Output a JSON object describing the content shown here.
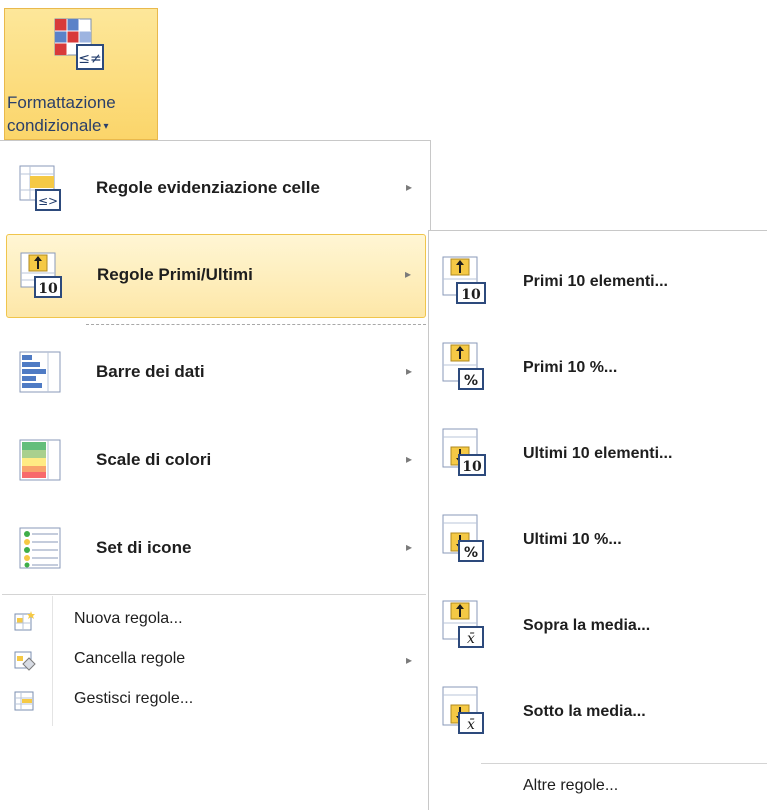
{
  "ribbon": {
    "button_line1": "Formattazione",
    "button_line2": "condizionale",
    "dropdown_arrow": "▾",
    "icon": "conditional-formatting-icon"
  },
  "menu": {
    "big_items": [
      {
        "label": "Regole evidenziazione celle",
        "icon": "highlight-cells-rules-icon",
        "arrow": "▸"
      },
      {
        "label": "Regole Primi/Ultimi",
        "icon": "top-bottom-rules-icon",
        "arrow": "▸"
      },
      {
        "label": "Barre dei dati",
        "icon": "data-bars-icon",
        "arrow": "▸"
      },
      {
        "label": "Scale di colori",
        "icon": "color-scales-icon",
        "arrow": "▸"
      },
      {
        "label": "Set di icone",
        "icon": "icon-sets-icon",
        "arrow": "▸"
      }
    ],
    "small_items": [
      {
        "label": "Nuova regola...",
        "icon": "new-rule-icon"
      },
      {
        "label": "Cancella regole",
        "icon": "clear-rules-icon",
        "arrow": "▸"
      },
      {
        "label": "Gestisci regole...",
        "icon": "manage-rules-icon"
      }
    ]
  },
  "submenu": {
    "items": [
      {
        "label": "Primi 10 elementi...",
        "icon": "top-10-items-icon"
      },
      {
        "label": "Primi 10 %...",
        "icon": "top-10-percent-icon"
      },
      {
        "label": "Ultimi 10 elementi...",
        "icon": "bottom-10-items-icon"
      },
      {
        "label": "Ultimi 10 %...",
        "icon": "bottom-10-percent-icon"
      },
      {
        "label": "Sopra la media...",
        "icon": "above-average-icon"
      },
      {
        "label": "Sotto la media...",
        "icon": "below-average-icon"
      }
    ],
    "more_rules": "Altre regole..."
  },
  "colors": {
    "highlight_fill": "#fde7a8",
    "highlight_border": "#f0c54c",
    "ribbon_text": "#2a3f6a"
  }
}
